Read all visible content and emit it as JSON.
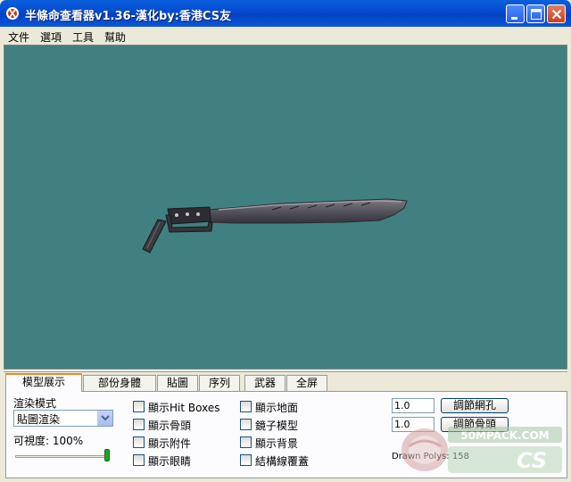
{
  "window": {
    "title": "半條命查看器v1.36-漢化by:香港CS友"
  },
  "menu": [
    "文件",
    "選項",
    "工具",
    "幫助"
  ],
  "tabs": [
    {
      "label": "模型展示",
      "active": true
    },
    {
      "label": "部份身體",
      "active": false
    },
    {
      "label": "貼圖",
      "active": false
    },
    {
      "label": "序列",
      "active": false
    },
    {
      "label": "武器",
      "active": false
    },
    {
      "label": "全屏",
      "active": false
    }
  ],
  "render": {
    "mode_label": "渲染模式",
    "mode_value": "貼圖渲染",
    "visibility_label": "可視度: 100%",
    "visibility_fraction": 1.0
  },
  "checkboxes": [
    {
      "label": "顯示Hit Boxes",
      "checked": false
    },
    {
      "label": "顯示骨頭",
      "checked": false
    },
    {
      "label": "顯示附件",
      "checked": false
    },
    {
      "label": "顯示眼睛",
      "checked": false
    },
    {
      "label": "顯示地面",
      "checked": false
    },
    {
      "label": "鏡子模型",
      "checked": false
    },
    {
      "label": "顯示背景",
      "checked": false
    },
    {
      "label": "結構線覆蓋",
      "checked": false
    }
  ],
  "adjust": {
    "grid_value": "1.0",
    "grid_button": "調節網孔",
    "bone_value": "1.0",
    "bone_button": "調節骨頭",
    "drawn_polys": "Drawn Polys: 158"
  },
  "watermark": {
    "site": "50MPACK.COM",
    "brand": "CS"
  },
  "colors": {
    "viewport_bg": "#408080",
    "titlebar": "#0349cf",
    "active_tab_accent": "#e68b2c"
  }
}
